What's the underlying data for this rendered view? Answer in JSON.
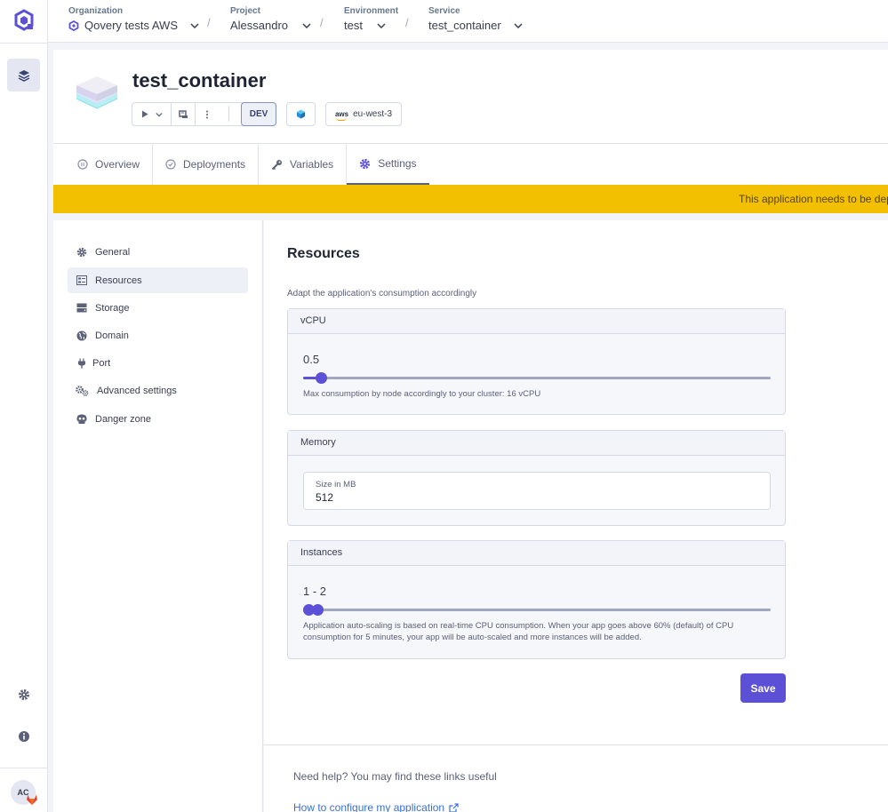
{
  "breadcrumb": [
    {
      "label": "Organization",
      "value": "Qovery tests AWS"
    },
    {
      "label": "Project",
      "value": "Alessandro"
    },
    {
      "label": "Environment",
      "value": "test"
    },
    {
      "label": "Service",
      "value": "test_container"
    }
  ],
  "app": {
    "title": "test_container",
    "env_tag": "DEV",
    "region": "eu-west-3",
    "aws_mark": "aws"
  },
  "tabs": [
    {
      "label": "Overview",
      "icon": "pause-circle-icon"
    },
    {
      "label": "Deployments",
      "icon": "check-circle-icon"
    },
    {
      "label": "Variables",
      "icon": "key-icon"
    },
    {
      "label": "Settings",
      "icon": "gear-icon",
      "active": true
    }
  ],
  "banner": {
    "text": "This application needs to be dep"
  },
  "settings_nav": [
    {
      "label": "General",
      "icon": "gear-icon"
    },
    {
      "label": "Resources",
      "icon": "resources-icon",
      "active": true
    },
    {
      "label": "Storage",
      "icon": "storage-icon"
    },
    {
      "label": "Domain",
      "icon": "globe-icon"
    },
    {
      "label": "Port",
      "icon": "plug-icon"
    },
    {
      "label": "Advanced settings",
      "icon": "gears-icon"
    },
    {
      "label": "Danger zone",
      "icon": "skull-icon"
    }
  ],
  "resources": {
    "title": "Resources",
    "description": "Adapt the application's consumption accordingly",
    "vcpu": {
      "label": "vCPU",
      "value": "0.5",
      "slider_fraction": 0.03,
      "hint": "Max consumption by node accordingly to your cluster: 16 vCPU"
    },
    "memory": {
      "label": "Memory",
      "field_label": "Size in MB",
      "value": "512"
    },
    "instances": {
      "label": "Instances",
      "value": "1 - 2",
      "hint_line1": "Application auto-scaling is based on real-time CPU consumption. When your app goes above 60% (default) of CPU",
      "hint_line2": "consumption for 5 minutes, your app will be auto-scaled and more instances will be added."
    },
    "save_label": "Save"
  },
  "help": {
    "text": "Need help? You may find these links useful",
    "link": "How to configure my application"
  },
  "user": {
    "initials": "AC"
  },
  "colors": {
    "accent": "#5b50d6",
    "banner": "#f2c000",
    "link": "#3a6fd6"
  }
}
